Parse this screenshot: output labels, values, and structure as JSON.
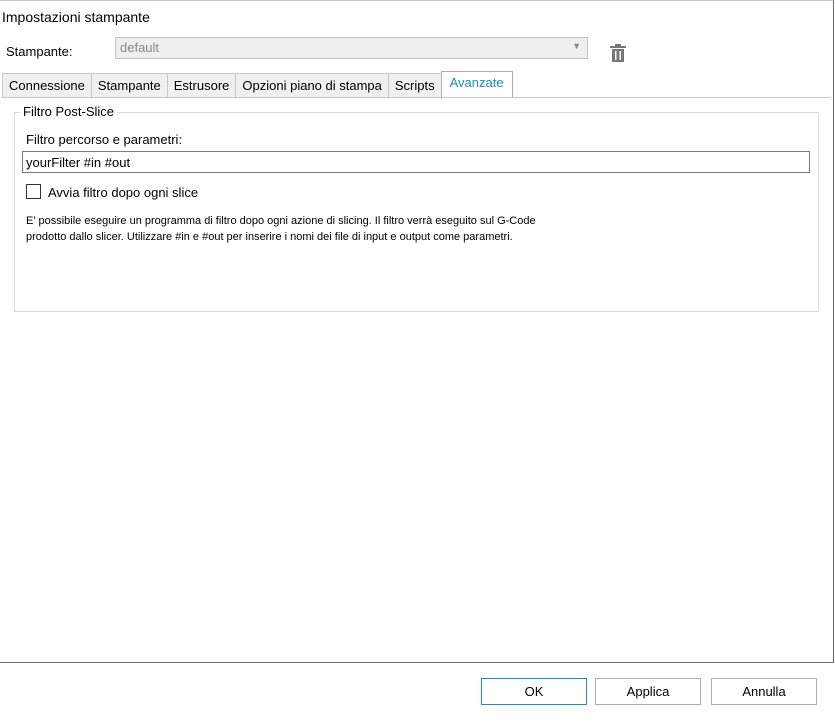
{
  "window": {
    "title": "Impostazioni stampante"
  },
  "printer": {
    "label": "Stampante:",
    "selected": "default",
    "delete_icon": "trash-icon"
  },
  "tabs": [
    {
      "label": "Connessione"
    },
    {
      "label": "Stampante"
    },
    {
      "label": "Estrusore"
    },
    {
      "label": "Opzioni piano di stampa"
    },
    {
      "label": "Scripts"
    },
    {
      "label": "Avanzate",
      "active": true
    }
  ],
  "advanced": {
    "group_title": "Filtro Post-Slice",
    "filter_label": "Filtro percorso e parametri:",
    "filter_value": "yourFilter #in #out",
    "run_filter_label": "Avvia filtro dopo ogni slice",
    "run_filter_checked": false,
    "description_line1": "E' possibile eseguire un programma di filtro dopo ogni azione di slicing. Il filtro verrà eseguito sul G-Code",
    "description_line2": "prodotto dallo slicer. Utilizzare #in e #out per inserire i nomi dei file di input e output come parametri."
  },
  "buttons": {
    "ok": "OK",
    "apply": "Applica",
    "cancel": "Annulla"
  },
  "colors": {
    "accent": "#1a8fc0"
  }
}
